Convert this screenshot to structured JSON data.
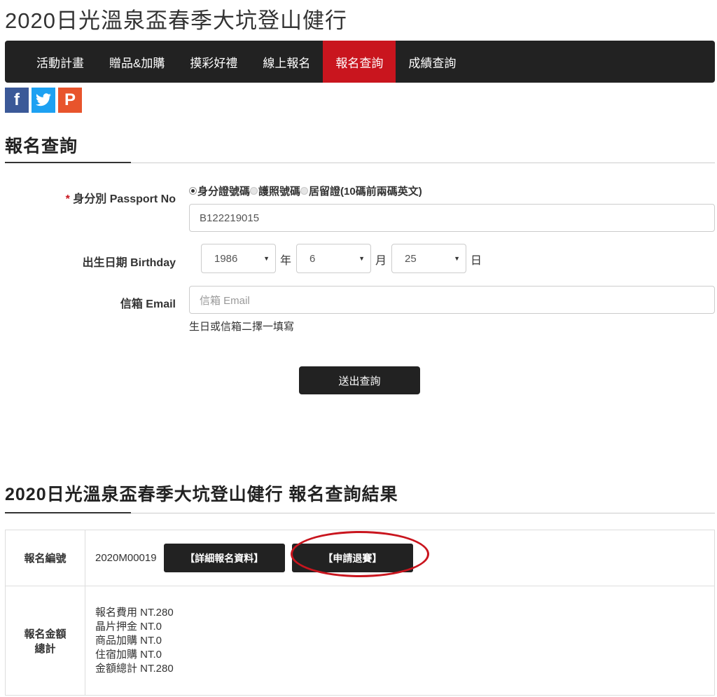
{
  "site_title": "2020日光溫泉盃春季大坑登山健行",
  "nav": [
    {
      "label": "活動計畫"
    },
    {
      "label": "贈品&加購"
    },
    {
      "label": "摸彩好禮"
    },
    {
      "label": "線上報名"
    },
    {
      "label": "報名查詢",
      "active": true
    },
    {
      "label": "成績查詢"
    }
  ],
  "social": [
    {
      "icon": "facebook-icon",
      "glyph": "f",
      "color": "#3b5998"
    },
    {
      "icon": "twitter-icon",
      "glyph": "t",
      "color": "#1da1f2"
    },
    {
      "icon": "plurk-icon",
      "glyph": "P",
      "color": "#e8542c"
    }
  ],
  "query": {
    "heading": "報名查詢",
    "id_label_required": "*",
    "id_label": "身分別 Passport No",
    "radio_options": [
      "身分證號碼",
      "護照號碼",
      "居留證(10碼前兩碼英文)"
    ],
    "radio_selected": "身分證號碼",
    "id_value": "B122219015",
    "birthday_label": "出生日期 Birthday",
    "year": "1986",
    "year_unit": "年",
    "month": "6",
    "month_unit": "月",
    "day": "25",
    "day_unit": "日",
    "email_label": "信箱 Email",
    "email_placeholder": "信箱 Email",
    "help_text": "生日或信箱二擇一填寫",
    "submit_label": "送出查詢"
  },
  "result": {
    "heading": "2020日光溫泉盃春季大坑登山健行 報名查詢結果",
    "reg_no_label": "報名編號",
    "reg_no": "2020M00019",
    "detail_button": "【詳細報名資料】",
    "withdraw_button": "【申請退賽】",
    "amount_label_1": "報名金額",
    "amount_label_2": "總計",
    "amounts": [
      "報名費用 NT.280",
      "晶片押金 NT.0",
      "商品加購 NT.0",
      "住宿加購 NT.0",
      "金額總計 NT.280"
    ]
  },
  "colors": {
    "accent": "#c9151e",
    "nav_bg": "#222222"
  }
}
